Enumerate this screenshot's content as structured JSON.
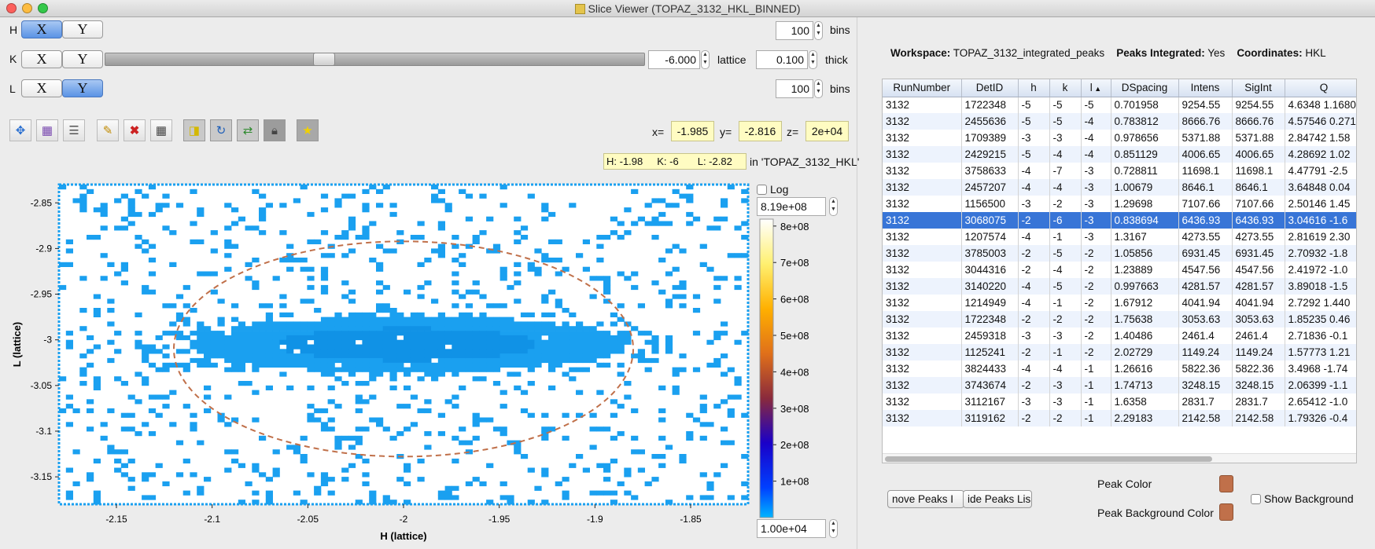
{
  "window": {
    "title": "Slice Viewer (TOPAZ_3132_HKL_BINNED)"
  },
  "dims": [
    {
      "label": "H",
      "x": "X",
      "y": "Y",
      "active": "X",
      "value": "100",
      "unit": "bins"
    },
    {
      "label": "K",
      "x": "X",
      "y": "Y",
      "active": "",
      "value": "-6.000",
      "unit": "lattice",
      "thick_value": "0.100",
      "thick_label": "thick",
      "slider_fraction": 0.4
    },
    {
      "label": "L",
      "x": "X",
      "y": "Y",
      "active": "Y",
      "value": "100",
      "unit": "bins"
    }
  ],
  "coords": {
    "x_label": "x=",
    "x": "-1.985",
    "y_label": "y=",
    "y": "-2.816",
    "z_label": "z=",
    "z": "2e+04",
    "hkl_h": "H: -1.98",
    "hkl_k": "K: -6",
    "hkl_l": "L: -2.82",
    "in_ws": "in 'TOPAZ_3132_HKL'"
  },
  "toolbar": {
    "icons": [
      "pan-zoom-icon",
      "rebin-icon",
      "line-overview-icon",
      "pencil-icon",
      "delete-icon",
      "grid-icon",
      "peak-info-icon",
      "refresh-icon",
      "sync-icon",
      "lock-icon",
      "star-icon"
    ]
  },
  "colorbar": {
    "log_label": "Log",
    "max": "8.19e+08",
    "min": "1.00e+04",
    "ticks": [
      "8e+08",
      "7e+08",
      "6e+08",
      "5e+08",
      "4e+08",
      "3e+08",
      "2e+08",
      "1e+08"
    ]
  },
  "plot": {
    "xlabel": "H (lattice)",
    "ylabel": "L (lattice)",
    "xticks": [
      "-2.15",
      "-2.1",
      "-2.05",
      "-2",
      "-1.95",
      "-1.9",
      "-1.85"
    ],
    "yticks": [
      "-2.85",
      "-2.9",
      "-2.95",
      "-3",
      "-3.05",
      "-3.1",
      "-3.15"
    ],
    "xlim": [
      -2.18,
      -1.82
    ],
    "ylim": [
      -3.18,
      -2.83
    ]
  },
  "info": {
    "ws_label": "Workspace:",
    "ws": "TOPAZ_3132_integrated_peaks",
    "pi_label": "Peaks Integrated:",
    "pi": "Yes",
    "co_label": "Coordinates:",
    "co": "HKL"
  },
  "table": {
    "columns": [
      "RunNumber",
      "DetID",
      "h",
      "k",
      "l",
      "DSpacing",
      "Intens",
      "SigInt",
      "Q"
    ],
    "rows": [
      [
        "3132",
        "1722348",
        "-5",
        "-5",
        "-5",
        "0.701958",
        "9254.55",
        "9254.55",
        "4.6348 1.1680"
      ],
      [
        "3132",
        "2455636",
        "-5",
        "-5",
        "-4",
        "0.783812",
        "8666.76",
        "8666.76",
        "4.57546 0.271"
      ],
      [
        "3132",
        "1709389",
        "-3",
        "-3",
        "-4",
        "0.978656",
        "5371.88",
        "5371.88",
        "2.84742 1.58"
      ],
      [
        "3132",
        "2429215",
        "-5",
        "-4",
        "-4",
        "0.851129",
        "4006.65",
        "4006.65",
        "4.28692 1.02"
      ],
      [
        "3132",
        "3758633",
        "-4",
        "-7",
        "-3",
        "0.728811",
        "11698.1",
        "11698.1",
        "4.47791 -2.5"
      ],
      [
        "3132",
        "2457207",
        "-4",
        "-4",
        "-3",
        "1.00679",
        "8646.1",
        "8646.1",
        "3.64848 0.04"
      ],
      [
        "3132",
        "1156500",
        "-3",
        "-2",
        "-3",
        "1.29698",
        "7107.66",
        "7107.66",
        "2.50146 1.45"
      ],
      [
        "3132",
        "3068075",
        "-2",
        "-6",
        "-3",
        "0.838694",
        "6436.93",
        "6436.93",
        "3.04616 -1.6"
      ],
      [
        "3132",
        "1207574",
        "-4",
        "-1",
        "-3",
        "1.3167",
        "4273.55",
        "4273.55",
        "2.81619 2.30"
      ],
      [
        "3132",
        "3785003",
        "-2",
        "-5",
        "-2",
        "1.05856",
        "6931.45",
        "6931.45",
        "2.70932 -1.8"
      ],
      [
        "3132",
        "3044316",
        "-2",
        "-4",
        "-2",
        "1.23889",
        "4547.56",
        "4547.56",
        "2.41972 -1.0"
      ],
      [
        "3132",
        "3140220",
        "-4",
        "-5",
        "-2",
        "0.997663",
        "4281.57",
        "4281.57",
        "3.89018 -1.5"
      ],
      [
        "3132",
        "1214949",
        "-4",
        "-1",
        "-2",
        "1.67912",
        "4041.94",
        "4041.94",
        "2.7292 1.440"
      ],
      [
        "3132",
        "1722348",
        "-2",
        "-2",
        "-2",
        "1.75638",
        "3053.63",
        "3053.63",
        "1.85235 0.46"
      ],
      [
        "3132",
        "2459318",
        "-3",
        "-3",
        "-2",
        "1.40486",
        "2461.4",
        "2461.4",
        "2.71836 -0.1"
      ],
      [
        "3132",
        "1125241",
        "-2",
        "-1",
        "-2",
        "2.02729",
        "1149.24",
        "1149.24",
        "1.57773 1.21"
      ],
      [
        "3132",
        "3824433",
        "-4",
        "-4",
        "-1",
        "1.26616",
        "5822.36",
        "5822.36",
        "3.4968 -1.74"
      ],
      [
        "3132",
        "3743674",
        "-2",
        "-3",
        "-1",
        "1.74713",
        "3248.15",
        "3248.15",
        "2.06399 -1.1"
      ],
      [
        "3132",
        "3112167",
        "-3",
        "-3",
        "-1",
        "1.6358",
        "2831.7",
        "2831.7",
        "2.65412 -1.0"
      ],
      [
        "3132",
        "3119162",
        "-2",
        "-2",
        "-1",
        "2.29183",
        "2142.58",
        "2142.58",
        "1.79326 -0.4"
      ]
    ],
    "selected_row": 7
  },
  "buttons": {
    "remove": "nove Peaks I",
    "hide": "ide Peaks Lis"
  },
  "peak_color_label": "Peak Color",
  "peak_bg_label": "Peak Background Color",
  "show_bg_label": "Show Background",
  "colors": {
    "peak": "#c0704a",
    "data": "#1aa0f0",
    "selection": "#3875d7"
  }
}
